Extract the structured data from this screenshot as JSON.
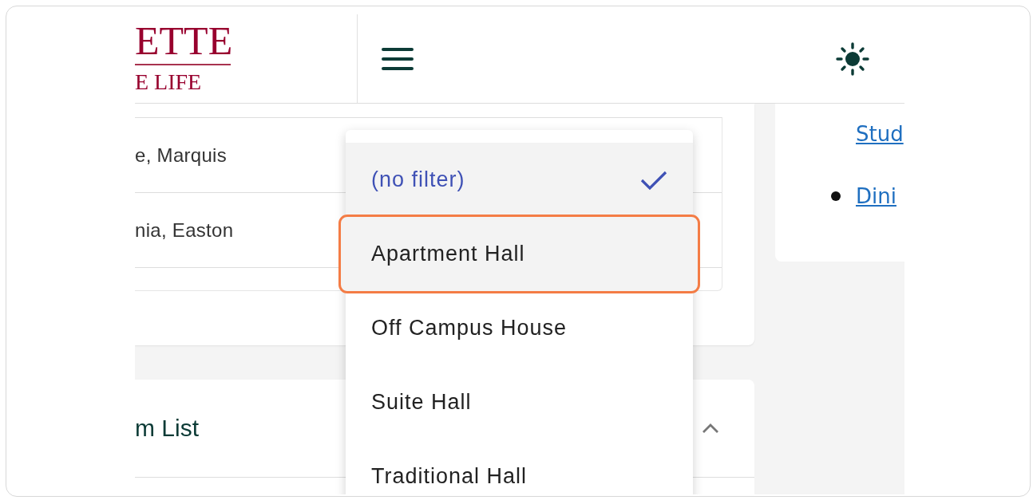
{
  "header": {
    "logo_top": "ETTE",
    "logo_bottom": "E LIFE"
  },
  "table": {
    "rows": [
      {
        "name": "e, Marquis"
      },
      {
        "name": "nia, Easton"
      }
    ]
  },
  "section": {
    "title": "m List",
    "expanded": true
  },
  "sidebar": {
    "links": [
      {
        "text": "Stud",
        "bullet": false
      },
      {
        "text": "Dini",
        "bullet": true
      }
    ]
  },
  "dropdown": {
    "options": [
      {
        "label": "(no filter)",
        "selected": true,
        "highlighted": false
      },
      {
        "label": "Apartment Hall",
        "selected": false,
        "highlighted": true
      },
      {
        "label": "Off Campus House",
        "selected": false,
        "highlighted": false
      },
      {
        "label": "Suite Hall",
        "selected": false,
        "highlighted": false
      },
      {
        "label": "Traditional Hall",
        "selected": false,
        "highlighted": false
      }
    ]
  }
}
